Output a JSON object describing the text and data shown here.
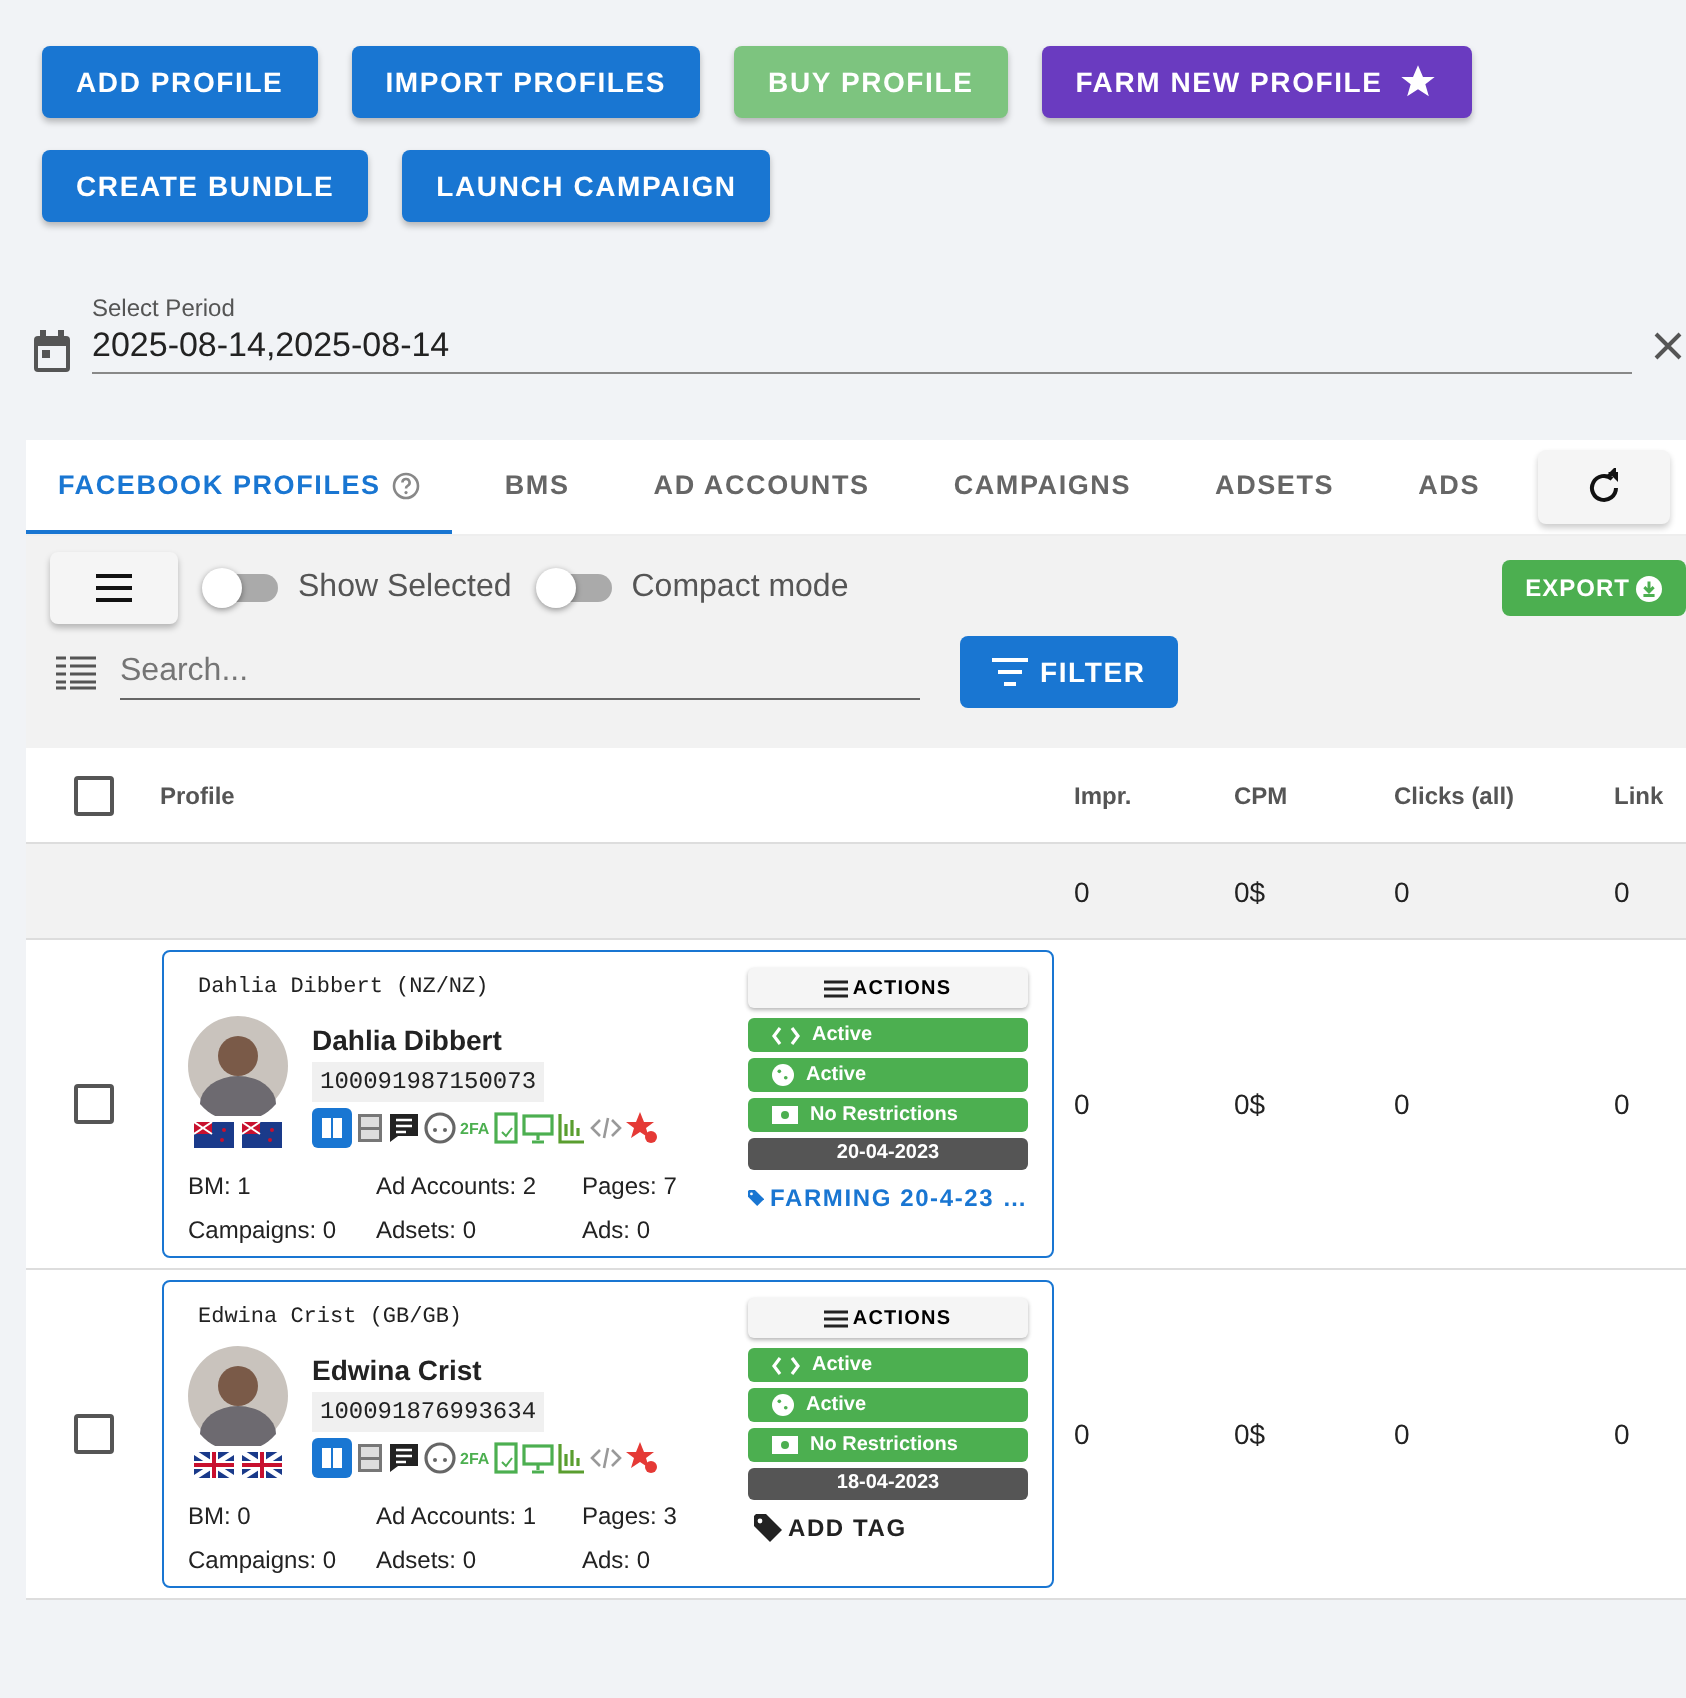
{
  "actions": [
    {
      "label": "ADD PROFILE",
      "kind": "primary"
    },
    {
      "label": "IMPORT PROFILES",
      "kind": "primary"
    },
    {
      "label": "BUY PROFILE",
      "kind": "muted"
    },
    {
      "label": "FARM NEW PROFILE",
      "kind": "purple"
    },
    {
      "label": "CREATE BUNDLE",
      "kind": "primary"
    },
    {
      "label": "LAUNCH CAMPAIGN",
      "kind": "primary"
    }
  ],
  "period": {
    "label": "Select Period",
    "value": "2025-08-14,2025-08-14"
  },
  "tabs": [
    {
      "label": "FACEBOOK PROFILES",
      "selected": true,
      "help": true
    },
    {
      "label": "BMS",
      "selected": false,
      "help": false
    },
    {
      "label": "AD ACCOUNTS",
      "selected": false,
      "help": false
    },
    {
      "label": "CAMPAIGNS",
      "selected": false,
      "help": false
    },
    {
      "label": "ADSETS",
      "selected": false,
      "help": false
    },
    {
      "label": "ADS",
      "selected": false,
      "help": false
    }
  ],
  "toolbar": {
    "toggles": [
      {
        "label": "Show Selected",
        "on": false
      },
      {
        "label": "Compact mode",
        "on": false
      }
    ],
    "export": "EXPORT",
    "search_placeholder": "Search...",
    "filter": "FILTER"
  },
  "table": {
    "select_all_checked": false,
    "profile_column": "Profile",
    "columns": [
      "Impr.",
      "CPM",
      "Clicks (all)",
      "Link"
    ],
    "totals": [
      "0",
      "0$",
      "0",
      "0"
    ],
    "rows": [
      {
        "checked": false,
        "profile": {
          "header": "Dahlia Dibbert (NZ/NZ)",
          "name": "Dahlia Dibbert",
          "id": "100091987150073",
          "flags": [
            {
              "kind": "nz"
            },
            {
              "kind": "nz"
            }
          ],
          "tfa": "2FA",
          "stats": [
            "BM: 1",
            "Ad Accounts: 2",
            "Pages: 7",
            "Campaigns: 0",
            "Adsets: 0",
            "Ads: 0"
          ],
          "actions": "ACTIONS",
          "statuses": [
            {
              "kind": "code",
              "label": "Active"
            },
            {
              "kind": "cookie",
              "label": "Active"
            },
            {
              "kind": "money",
              "label": "No Restrictions"
            }
          ],
          "date": "20-04-2023",
          "tag": {
            "kind": "tag",
            "label": "FARMING 20-4-23 …"
          }
        },
        "cells": [
          "0",
          "0$",
          "0",
          "0"
        ]
      },
      {
        "checked": false,
        "profile": {
          "header": "Edwina Crist (GB/GB)",
          "name": "Edwina Crist",
          "id": "100091876993634",
          "flags": [
            {
              "kind": "gb"
            },
            {
              "kind": "gb"
            }
          ],
          "tfa": "2FA",
          "stats": [
            "BM: 0",
            "Ad Accounts: 1",
            "Pages: 3",
            "Campaigns: 0",
            "Adsets: 0",
            "Ads: 0"
          ],
          "actions": "ACTIONS",
          "statuses": [
            {
              "kind": "code",
              "label": "Active"
            },
            {
              "kind": "cookie",
              "label": "Active"
            },
            {
              "kind": "money",
              "label": "No Restrictions"
            }
          ],
          "date": "18-04-2023",
          "tag": {
            "kind": "add",
            "label": "ADD TAG"
          }
        },
        "cells": [
          "0",
          "0$",
          "0",
          "0"
        ]
      }
    ]
  }
}
